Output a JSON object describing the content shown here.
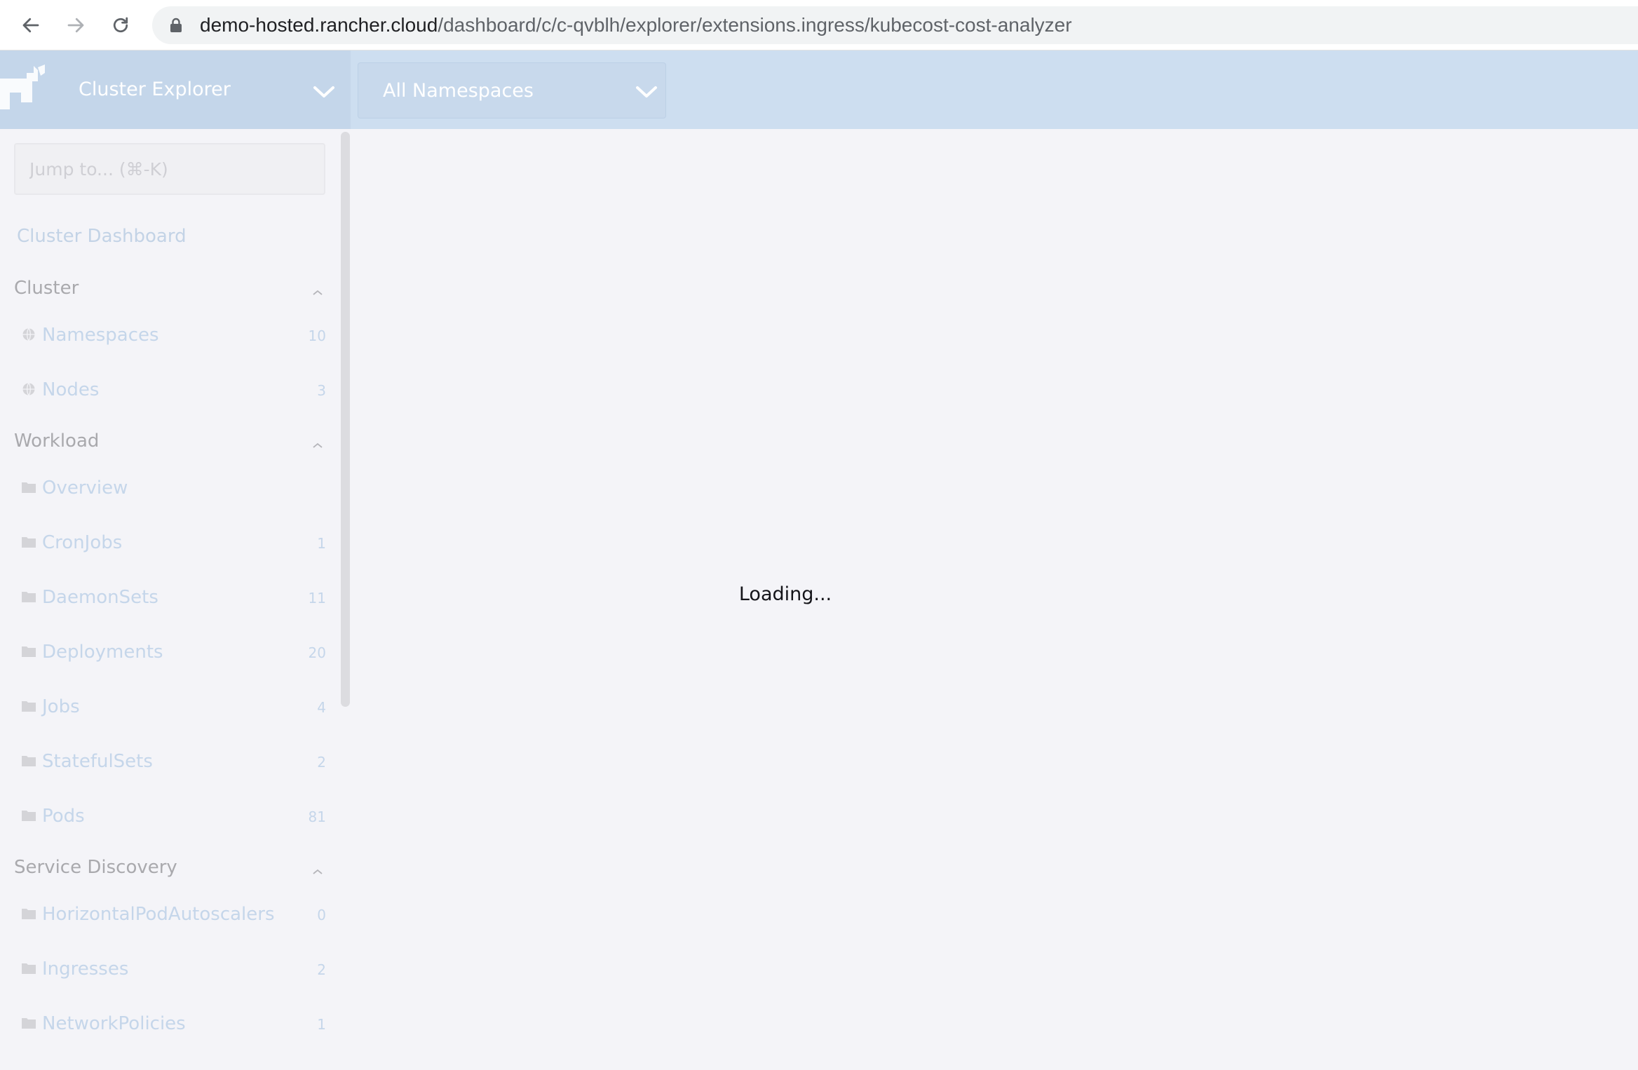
{
  "browser": {
    "url_host": "demo-hosted.rancher.cloud",
    "url_path": "/dashboard/c/c-qvblh/explorer/extensions.ingress/kubecost-cost-analyzer"
  },
  "header": {
    "cluster_title": "Cluster Explorer",
    "namespace_selected": "All Namespaces"
  },
  "sidebar": {
    "jump_placeholder": "Jump to... (⌘-K)",
    "dashboard_link": "Cluster Dashboard",
    "groups": [
      {
        "title": "Cluster",
        "items": [
          {
            "label": "Namespaces",
            "count": "10",
            "icon": "globe-icon"
          },
          {
            "label": "Nodes",
            "count": "3",
            "icon": "globe-icon"
          }
        ]
      },
      {
        "title": "Workload",
        "items": [
          {
            "label": "Overview",
            "count": "",
            "icon": "folder-icon"
          },
          {
            "label": "CronJobs",
            "count": "1",
            "icon": "folder-icon"
          },
          {
            "label": "DaemonSets",
            "count": "11",
            "icon": "folder-icon"
          },
          {
            "label": "Deployments",
            "count": "20",
            "icon": "folder-icon"
          },
          {
            "label": "Jobs",
            "count": "4",
            "icon": "folder-icon"
          },
          {
            "label": "StatefulSets",
            "count": "2",
            "icon": "folder-icon"
          },
          {
            "label": "Pods",
            "count": "81",
            "icon": "folder-icon"
          }
        ]
      },
      {
        "title": "Service Discovery",
        "items": [
          {
            "label": "HorizontalPodAutoscalers",
            "count": "0",
            "icon": "folder-icon"
          },
          {
            "label": "Ingresses",
            "count": "2",
            "icon": "folder-icon"
          },
          {
            "label": "NetworkPolicies",
            "count": "1",
            "icon": "folder-icon"
          }
        ]
      }
    ]
  },
  "main": {
    "loading_text": "Loading..."
  },
  "colors": {
    "header_bg": "#cddef0",
    "page_bg": "#f4f4f8",
    "nav_text": "#c5d6ea",
    "group_text": "#a9a9ad"
  }
}
